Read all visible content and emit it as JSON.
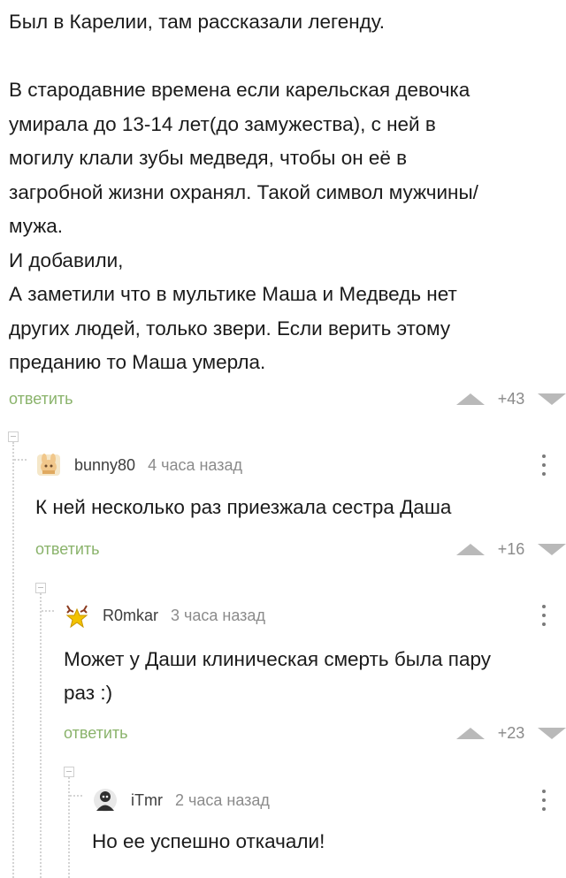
{
  "post": {
    "lines": [
      "Был в Карелии, там рассказали легенду.",
      "",
      "В стародавние времена если карельская девочка",
      "умирала до 13-14 лет(до замужества), с ней в",
      "могилу клали зубы медведя, чтобы он её в",
      "загробной жизни охранял. Такой символ мужчины/",
      "мужа.",
      "И добавили,",
      "А заметили что в мультике Маша и Медведь нет",
      "других людей, только звери. Если верить этому",
      "преданию то Маша умерла."
    ],
    "reply_label": "ответить",
    "score": "+43"
  },
  "comments": [
    {
      "username": "bunny80",
      "time": "4 часа назад",
      "avatar_icon": "bunny-avatar-icon",
      "lines": [
        "К ней несколько раз приезжала сестра Даша"
      ],
      "reply_label": "ответить",
      "score": "+16"
    },
    {
      "username": "R0mkar",
      "time": "3 часа назад",
      "avatar_icon": "star-antlers-avatar-icon",
      "lines": [
        "Может у Даши клиническая смерть была пару",
        "раз :)"
      ],
      "reply_label": "ответить",
      "score": "+23"
    },
    {
      "username": "iTmr",
      "time": "2 часа назад",
      "avatar_icon": "person-avatar-icon",
      "lines": [
        "Но ее успешно откачали!"
      ]
    }
  ],
  "colors": {
    "reply_link": "#8ab36b",
    "vote_arrow": "#b9b9b9",
    "text": "#1b1b1b",
    "muted": "#8b8b8b"
  }
}
